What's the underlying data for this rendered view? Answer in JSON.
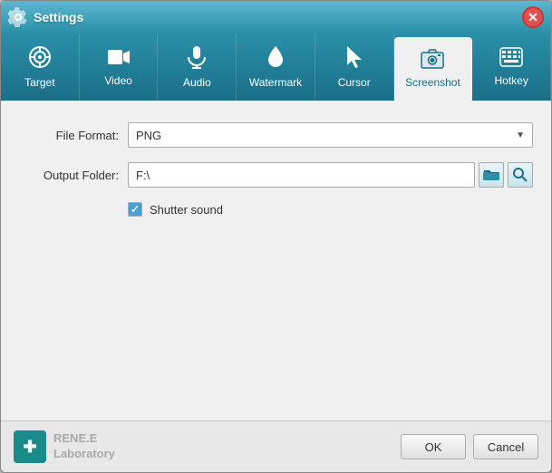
{
  "window": {
    "title": "Settings",
    "close_label": "✕"
  },
  "tabs": [
    {
      "id": "target",
      "label": "Target",
      "icon": "⊕",
      "active": false
    },
    {
      "id": "video",
      "label": "Video",
      "icon": "🎥",
      "active": false
    },
    {
      "id": "audio",
      "label": "Audio",
      "icon": "🎤",
      "active": false
    },
    {
      "id": "watermark",
      "label": "Watermark",
      "icon": "💧",
      "active": false
    },
    {
      "id": "cursor",
      "label": "Cursor",
      "icon": "➤",
      "active": false
    },
    {
      "id": "screenshot",
      "label": "Screenshot",
      "icon": "📷",
      "active": true
    },
    {
      "id": "hotkey",
      "label": "Hotkey",
      "icon": "⌨",
      "active": false
    }
  ],
  "form": {
    "file_format_label": "File Format:",
    "file_format_value": "PNG",
    "output_folder_label": "Output Folder:",
    "output_folder_value": "F:\\",
    "shutter_sound_label": "Shutter sound",
    "shutter_sound_checked": true
  },
  "footer": {
    "logo_text_line1": "RENE.E",
    "logo_text_line2": "Laboratory",
    "ok_label": "OK",
    "cancel_label": "Cancel"
  }
}
